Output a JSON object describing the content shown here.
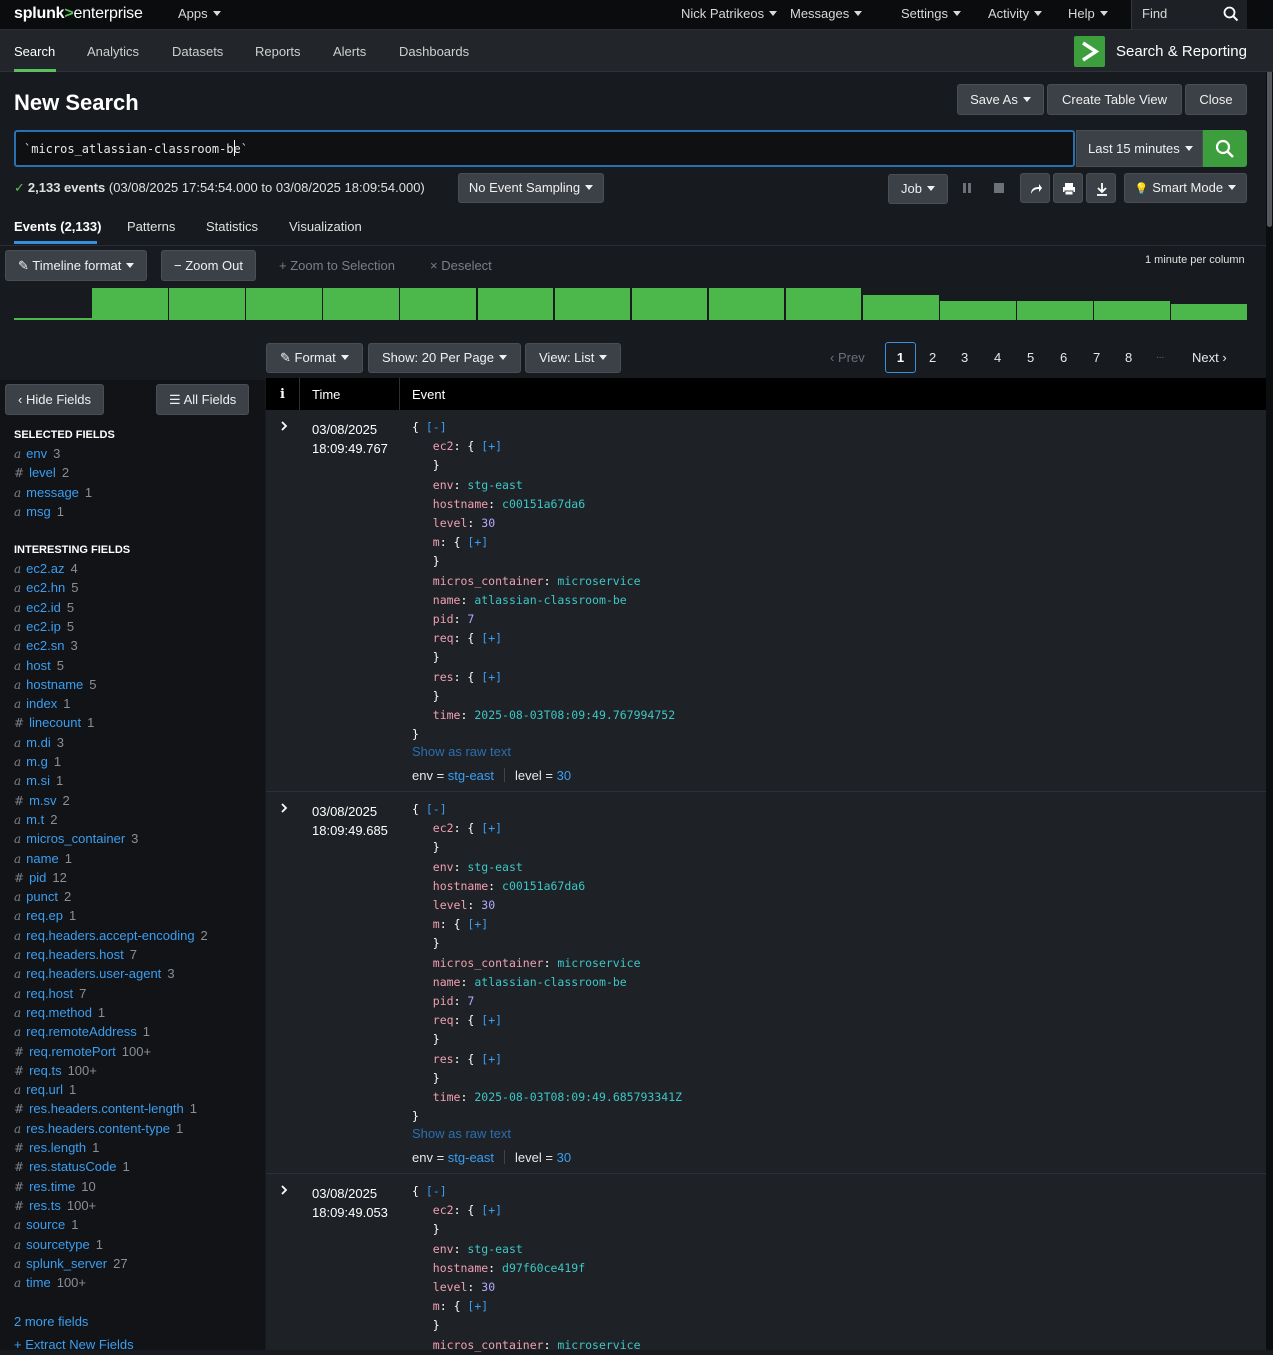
{
  "topbar": {
    "logo_a": "splunk",
    "logo_b": ">",
    "logo_c": "enterprise",
    "apps": "Apps",
    "user": "Nick Patrikeos",
    "messages": "Messages",
    "settings": "Settings",
    "activity": "Activity",
    "help": "Help",
    "find_placeholder": "Find"
  },
  "nav": {
    "tabs": [
      "Search",
      "Analytics",
      "Datasets",
      "Reports",
      "Alerts",
      "Dashboards"
    ],
    "app_title": "Search & Reporting"
  },
  "page": {
    "title": "New Search",
    "save_as": "Save As",
    "create_table": "Create Table View",
    "close": "Close"
  },
  "search": {
    "query": "`micros_atlassian-classroom-be`",
    "time_range": "Last 15 minutes"
  },
  "status": {
    "count": "2,133 events",
    "range": "(03/08/2025 17:54:54.000 to 03/08/2025 18:09:54.000)",
    "sampling": "No Event Sampling",
    "job": "Job",
    "mode": "Smart Mode"
  },
  "subtabs": [
    "Events (2,133)",
    "Patterns",
    "Statistics",
    "Visualization"
  ],
  "timeline": {
    "format": "Timeline format",
    "zoom_out": "Zoom Out",
    "zoom_sel": "Zoom to Selection",
    "deselect": "Deselect",
    "per_column": "1 minute per column",
    "bar_levels": [
      1,
      1,
      1,
      1,
      1,
      1,
      1,
      1,
      1,
      1,
      0.78,
      0.6,
      0.6,
      0.6,
      0.5
    ]
  },
  "results_controls": {
    "format": "Format",
    "show": "Show: 20 Per Page",
    "view": "View: List",
    "prev": "Prev",
    "pages": [
      "1",
      "2",
      "3",
      "4",
      "5",
      "6",
      "7",
      "8"
    ],
    "ellipsis": "...",
    "next": "Next"
  },
  "sidebar": {
    "hide_fields": "Hide Fields",
    "all_fields": "All Fields",
    "selected_title": "SELECTED FIELDS",
    "selected": [
      {
        "t": "a",
        "n": "env",
        "c": "3"
      },
      {
        "t": "#",
        "n": "level",
        "c": "2"
      },
      {
        "t": "a",
        "n": "message",
        "c": "1"
      },
      {
        "t": "a",
        "n": "msg",
        "c": "1"
      }
    ],
    "interesting_title": "INTERESTING FIELDS",
    "interesting": [
      {
        "t": "a",
        "n": "ec2.az",
        "c": "4"
      },
      {
        "t": "a",
        "n": "ec2.hn",
        "c": "5"
      },
      {
        "t": "a",
        "n": "ec2.id",
        "c": "5"
      },
      {
        "t": "a",
        "n": "ec2.ip",
        "c": "5"
      },
      {
        "t": "a",
        "n": "ec2.sn",
        "c": "3"
      },
      {
        "t": "a",
        "n": "host",
        "c": "5"
      },
      {
        "t": "a",
        "n": "hostname",
        "c": "5"
      },
      {
        "t": "a",
        "n": "index",
        "c": "1"
      },
      {
        "t": "#",
        "n": "linecount",
        "c": "1"
      },
      {
        "t": "a",
        "n": "m.di",
        "c": "3"
      },
      {
        "t": "a",
        "n": "m.g",
        "c": "1"
      },
      {
        "t": "a",
        "n": "m.si",
        "c": "1"
      },
      {
        "t": "#",
        "n": "m.sv",
        "c": "2"
      },
      {
        "t": "a",
        "n": "m.t",
        "c": "2"
      },
      {
        "t": "a",
        "n": "micros_container",
        "c": "3"
      },
      {
        "t": "a",
        "n": "name",
        "c": "1"
      },
      {
        "t": "#",
        "n": "pid",
        "c": "12"
      },
      {
        "t": "a",
        "n": "punct",
        "c": "2"
      },
      {
        "t": "a",
        "n": "req.ep",
        "c": "1"
      },
      {
        "t": "a",
        "n": "req.headers.accept-encoding",
        "c": "2"
      },
      {
        "t": "a",
        "n": "req.headers.host",
        "c": "7"
      },
      {
        "t": "a",
        "n": "req.headers.user-agent",
        "c": "3"
      },
      {
        "t": "a",
        "n": "req.host",
        "c": "7"
      },
      {
        "t": "a",
        "n": "req.method",
        "c": "1"
      },
      {
        "t": "a",
        "n": "req.remoteAddress",
        "c": "1"
      },
      {
        "t": "#",
        "n": "req.remotePort",
        "c": "100+"
      },
      {
        "t": "#",
        "n": "req.ts",
        "c": "100+"
      },
      {
        "t": "a",
        "n": "req.url",
        "c": "1"
      },
      {
        "t": "#",
        "n": "res.headers.content-length",
        "c": "1"
      },
      {
        "t": "a",
        "n": "res.headers.content-type",
        "c": "1"
      },
      {
        "t": "#",
        "n": "res.length",
        "c": "1"
      },
      {
        "t": "#",
        "n": "res.statusCode",
        "c": "1"
      },
      {
        "t": "#",
        "n": "res.time",
        "c": "10"
      },
      {
        "t": "#",
        "n": "res.ts",
        "c": "100+"
      },
      {
        "t": "a",
        "n": "source",
        "c": "1"
      },
      {
        "t": "a",
        "n": "sourcetype",
        "c": "1"
      },
      {
        "t": "a",
        "n": "splunk_server",
        "c": "27"
      },
      {
        "t": "a",
        "n": "time",
        "c": "100+"
      }
    ],
    "more_fields": "2 more fields",
    "extract": "+ Extract New Fields"
  },
  "table": {
    "col_i": "i",
    "col_time": "Time",
    "col_event": "Event",
    "raw_link": "Show as raw text",
    "events": [
      {
        "date": "03/08/2025",
        "time": "18:09:49.767",
        "hostname": "c00151a67da6",
        "ts": "2025-08-03T08:09:49.767994752",
        "env": "stg-east",
        "level": "30",
        "container": "microservice",
        "name": "atlassian-classroom-be",
        "pid": "7"
      },
      {
        "date": "03/08/2025",
        "time": "18:09:49.685",
        "hostname": "c00151a67da6",
        "ts": "2025-08-03T08:09:49.685793341Z",
        "env": "stg-east",
        "level": "30",
        "container": "microservice",
        "name": "atlassian-classroom-be",
        "pid": "7"
      },
      {
        "date": "03/08/2025",
        "time": "18:09:49.053",
        "hostname": "d97f60ce419f",
        "ts": "",
        "env": "stg-east",
        "level": "30",
        "container": "microservice",
        "name": "",
        "pid": ""
      }
    ]
  }
}
